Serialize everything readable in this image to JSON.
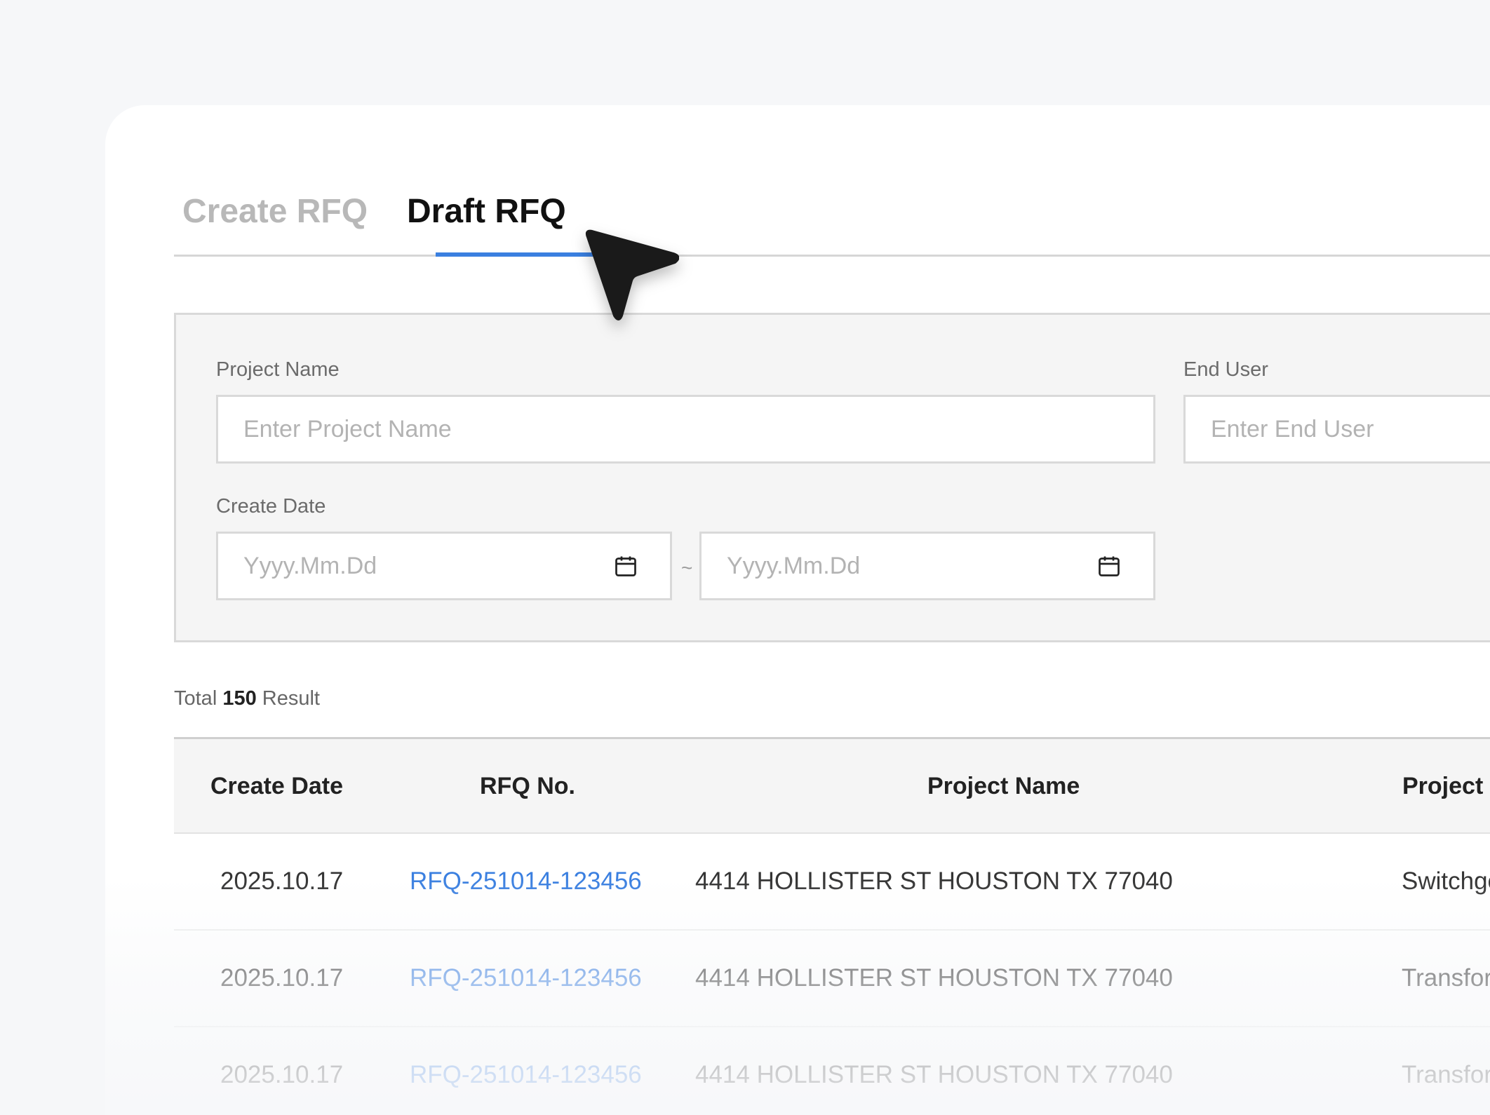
{
  "tabs": {
    "create": "Create RFQ",
    "draft": "Draft RFQ",
    "active": "draft"
  },
  "filters": {
    "project_name": {
      "label": "Project Name",
      "placeholder": "Enter Project Name"
    },
    "end_user": {
      "label": "End User",
      "placeholder": "Enter End User"
    },
    "create_date": {
      "label": "Create Date",
      "from_placeholder": "Yyyy.Mm.Dd",
      "to_placeholder": "Yyyy.Mm.Dd",
      "separator": "~"
    }
  },
  "results": {
    "prefix": "Total",
    "count": "150",
    "suffix": "Result"
  },
  "table": {
    "headers": [
      "Create Date",
      "RFQ No.",
      "Project Name",
      "Project"
    ],
    "rows": [
      {
        "date": "2025.10.17",
        "rfq": "RFQ-251014-123456",
        "project_name": "4414 HOLLISTER ST  HOUSTON TX 77040",
        "project_type": "Switchgear"
      },
      {
        "date": "2025.10.17",
        "rfq": "RFQ-251014-123456",
        "project_name": "4414 HOLLISTER ST  HOUSTON TX 77040",
        "project_type": "Transformer"
      },
      {
        "date": "2025.10.17",
        "rfq": "RFQ-251014-123456",
        "project_name": "4414 HOLLISTER ST  HOUSTON TX 77040",
        "project_type": "Transformer"
      }
    ]
  },
  "colors": {
    "accent": "#3a7fe0",
    "tab_inactive": "#b8b8b8",
    "panel_bg": "#f5f5f5",
    "page_bg": "#f6f7f9"
  },
  "icons": {
    "date_from": "calendar-icon",
    "date_to": "calendar-icon",
    "pointer": "mouse-cursor-icon"
  }
}
